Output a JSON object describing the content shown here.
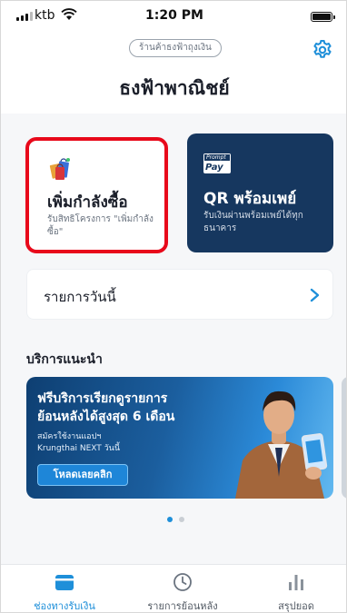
{
  "status_bar": {
    "carrier": "ktb",
    "time": "1:20 PM",
    "icons": [
      "signal-icon",
      "wifi-icon",
      "battery-icon"
    ]
  },
  "header": {
    "store_type": "ร้านค้าธงฟ้าถุงเงิน",
    "shop_name": "ธงฟ้าพาณิชย์",
    "settings_icon": "gear-icon"
  },
  "cards": {
    "boost": {
      "title": "เพิ่มกำลังซื้อ",
      "subtitle": "รับสิทธิโครงการ \"เพิ่มกำลังซื้อ\"",
      "icon": "shopping-bags-icon",
      "highlight_color": "#e8091b"
    },
    "qr": {
      "title": "QR พร้อมเพย์",
      "subtitle": "รับเงินผ่านพร้อมเพย์ได้ทุกธนาคาร",
      "logo_top": "Prompt",
      "logo_bottom": "Pay",
      "color": "#16375f"
    }
  },
  "today": {
    "label": "รายการวันนี้"
  },
  "recommended": {
    "title": "บริการแนะนำ",
    "banner": {
      "line1": "ฟรีบริการเรียกดูรายการ",
      "line2_prefix": "ย้อนหลังได้สูงสุด",
      "line2_big": "6 เดือน",
      "line3": "สมัครใช้งานแอปฯ",
      "line4": "Krungthai NEXT วันนี้",
      "cta": "โหลดเลยคลิก"
    },
    "carousel": {
      "pages": 2,
      "active": 1
    }
  },
  "tabs": [
    {
      "label": "ช่องทางรับเงิน",
      "icon": "wallet-icon",
      "active": true
    },
    {
      "label": "รายการย้อนหลัง",
      "icon": "clock-icon",
      "active": false
    },
    {
      "label": "สรุปยอด",
      "icon": "bar-chart-icon",
      "active": false
    }
  ],
  "colors": {
    "accent": "#1e8fd9",
    "navy": "#16375f",
    "highlight_red": "#e8091b",
    "background": "#f6f7f9"
  }
}
